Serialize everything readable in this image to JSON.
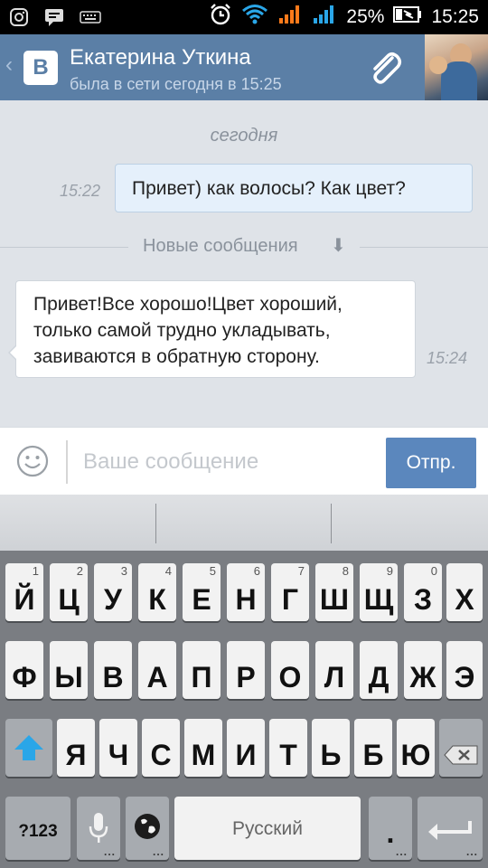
{
  "status_bar": {
    "battery": "25%",
    "time": "15:25",
    "icons": [
      "instagram-icon",
      "message-icon",
      "keyboard-icon",
      "alarm-icon",
      "wifi-icon",
      "signal-icon",
      "signal-icon",
      "battery-icon"
    ]
  },
  "header": {
    "name": "Екатерина Уткина",
    "status": "была в сети сегодня в 15:25",
    "logo": "В",
    "icons": [
      "back-chevron-icon",
      "vk-logo",
      "paperclip-icon",
      "avatar"
    ]
  },
  "chat": {
    "date_label": "сегодня",
    "messages": [
      {
        "direction": "out",
        "time": "15:22",
        "text": "Привет) как волосы? Как цвет?"
      },
      {
        "direction": "in",
        "time": "15:24",
        "lines": [
          "Привет!Все хорошо!Цвет хороший,",
          "только самой трудно укладывать,",
          "завиваются в обратную сторону."
        ]
      }
    ],
    "new_messages_label": "Новые сообщения"
  },
  "composer": {
    "placeholder": "Ваше сообщение",
    "send_label": "Отпр."
  },
  "keyboard": {
    "row1": [
      {
        "label": "Й",
        "hint": "1"
      },
      {
        "label": "Ц",
        "hint": "2"
      },
      {
        "label": "У",
        "hint": "3"
      },
      {
        "label": "К",
        "hint": "4"
      },
      {
        "label": "Е",
        "hint": "5"
      },
      {
        "label": "Н",
        "hint": "6"
      },
      {
        "label": "Г",
        "hint": "7"
      },
      {
        "label": "Ш",
        "hint": "8"
      },
      {
        "label": "Щ",
        "hint": "9"
      },
      {
        "label": "З",
        "hint": "0"
      },
      {
        "label": "Х",
        "hint": ""
      }
    ],
    "row2": [
      "Ф",
      "Ы",
      "В",
      "А",
      "П",
      "Р",
      "О",
      "Л",
      "Д",
      "Ж",
      "Э"
    ],
    "row3": [
      "Я",
      "Ч",
      "С",
      "М",
      "И",
      "Т",
      "Ь",
      "Б",
      "Ю"
    ],
    "mode_label": "?123",
    "space_label": "Русский",
    "period_label": ".",
    "colors": {
      "send": "#5b87bd",
      "header": "#5b7fa6",
      "shift": "#2aa6e8"
    }
  }
}
